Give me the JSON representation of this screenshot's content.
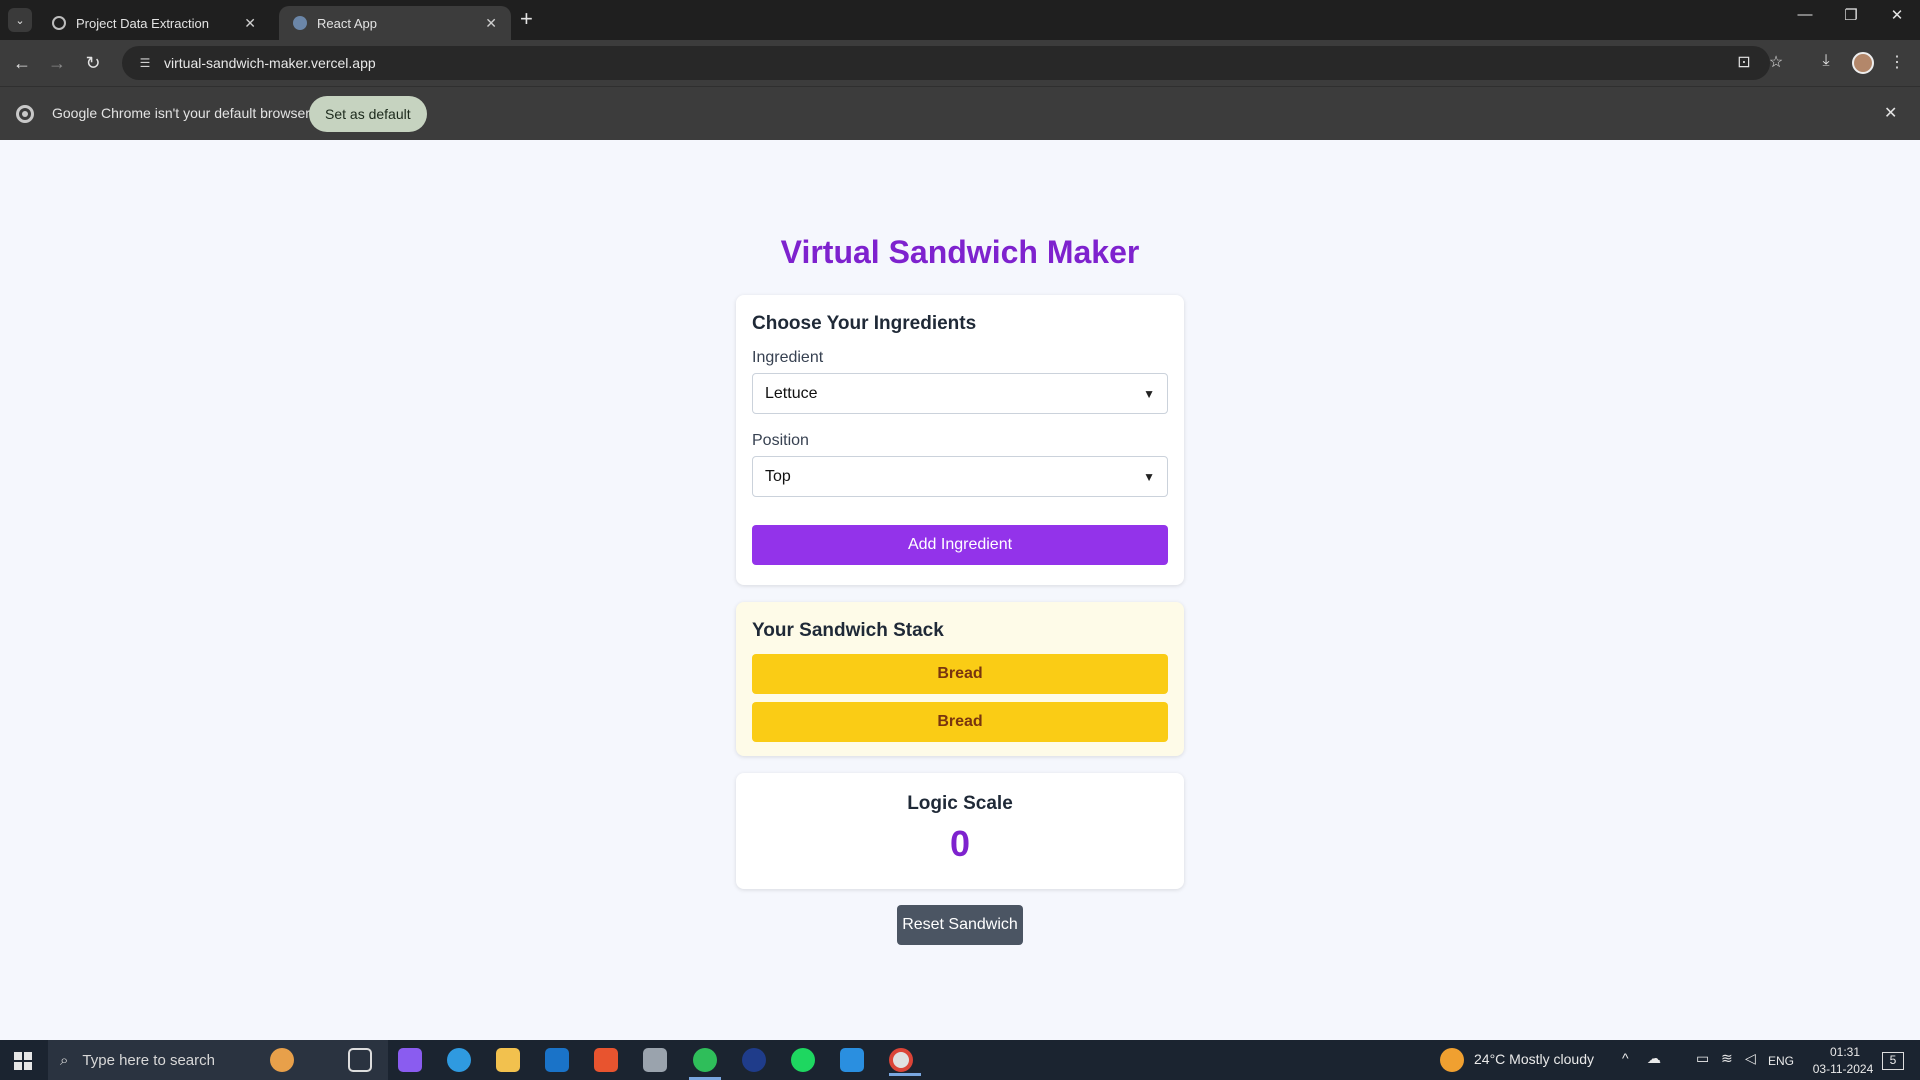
{
  "browser": {
    "tabs": [
      {
        "title": "Project Data Extraction",
        "active": false
      },
      {
        "title": "React App",
        "active": true
      }
    ],
    "url": "virtual-sandwich-maker.vercel.app",
    "infobar": {
      "message": "Google Chrome isn't your default browser",
      "button": "Set as default"
    }
  },
  "app": {
    "title": "Virtual Sandwich Maker",
    "form": {
      "heading": "Choose Your Ingredients",
      "ingredient_label": "Ingredient",
      "ingredient_value": "Lettuce",
      "position_label": "Position",
      "position_value": "Top",
      "add_button": "Add Ingredient"
    },
    "stack": {
      "heading": "Your Sandwich Stack",
      "layers": [
        "Bread",
        "Bread"
      ]
    },
    "scale": {
      "heading": "Logic Scale",
      "value": "0"
    },
    "reset_button": "Reset Sandwich"
  },
  "taskbar": {
    "search_placeholder": "Type here to search",
    "weather": "24°C  Mostly cloudy",
    "language": "ENG",
    "time": "01:31",
    "date": "03-11-2024",
    "notifications": "5"
  },
  "colors": {
    "accent_purple": "#9333ea",
    "title_purple": "#7e22ce",
    "bread_yellow": "#facc15",
    "reset_gray": "#4b5563"
  }
}
